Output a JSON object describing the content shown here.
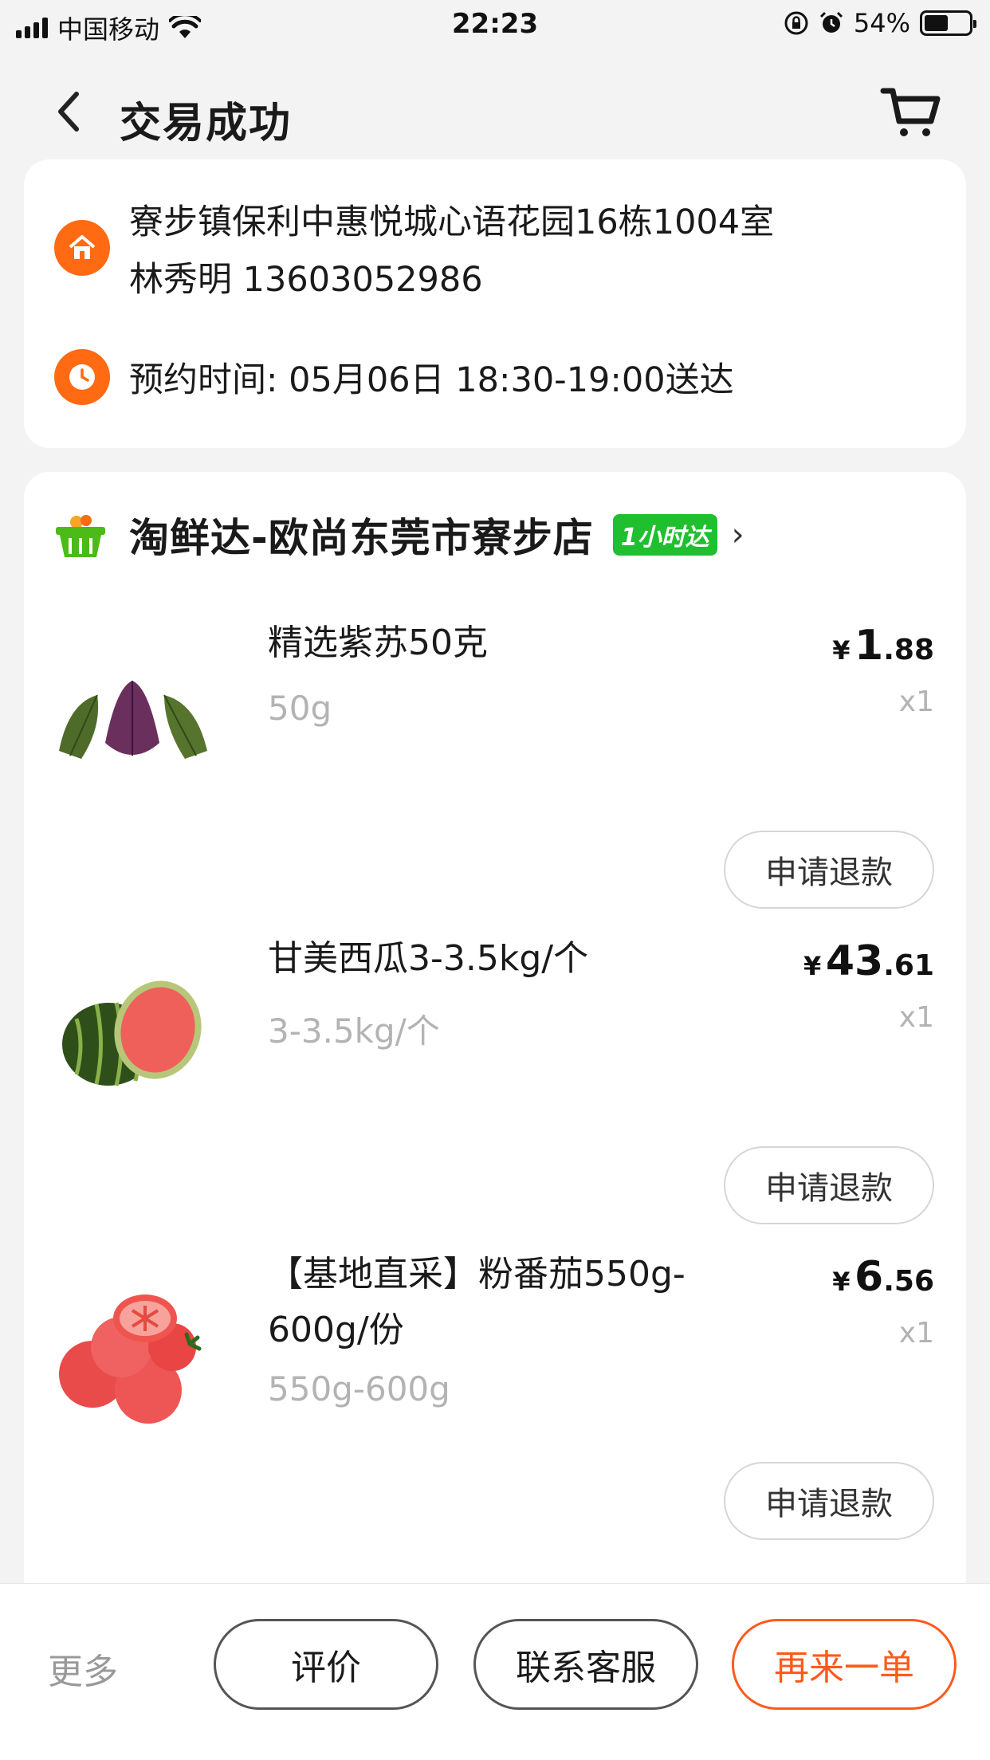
{
  "status_bar": {
    "carrier": "中国移动",
    "time": "22:23",
    "battery": "54%"
  },
  "nav": {
    "title": "交易成功"
  },
  "address": {
    "line1": "寮步镇保利中惠悦城心语花园16栋1004室",
    "line2": "林秀明  13603052986",
    "schedule": "预约时间: 05月06日 18:30-19:00送达"
  },
  "store": {
    "name": "淘鲜达-欧尚东莞市寮步店",
    "badge": "1小时达"
  },
  "items": [
    {
      "name": "精选紫苏50克",
      "spec": "50g",
      "price_currency": "¥",
      "price_int": "1",
      "price_dec": ".88",
      "qty": "x1",
      "refund_label": "申请退款"
    },
    {
      "name": "甘美西瓜3-3.5kg/个",
      "spec": "3-3.5kg/个",
      "price_currency": "¥",
      "price_int": "43",
      "price_dec": ".61",
      "qty": "x1",
      "refund_label": "申请退款"
    },
    {
      "name": "【基地直采】粉番茄550g-600g/份",
      "spec": "550g-600g",
      "price_currency": "¥",
      "price_int": "6",
      "price_dec": ".56",
      "qty": "x1",
      "refund_label": "申请退款"
    }
  ],
  "bottom": {
    "more": "更多",
    "review": "评价",
    "contact": "联系客服",
    "reorder": "再来一单"
  },
  "colors": {
    "accent": "#ff5a1a",
    "icon_orange": "#ff6a13",
    "badge_green": "#1fbf2f"
  }
}
